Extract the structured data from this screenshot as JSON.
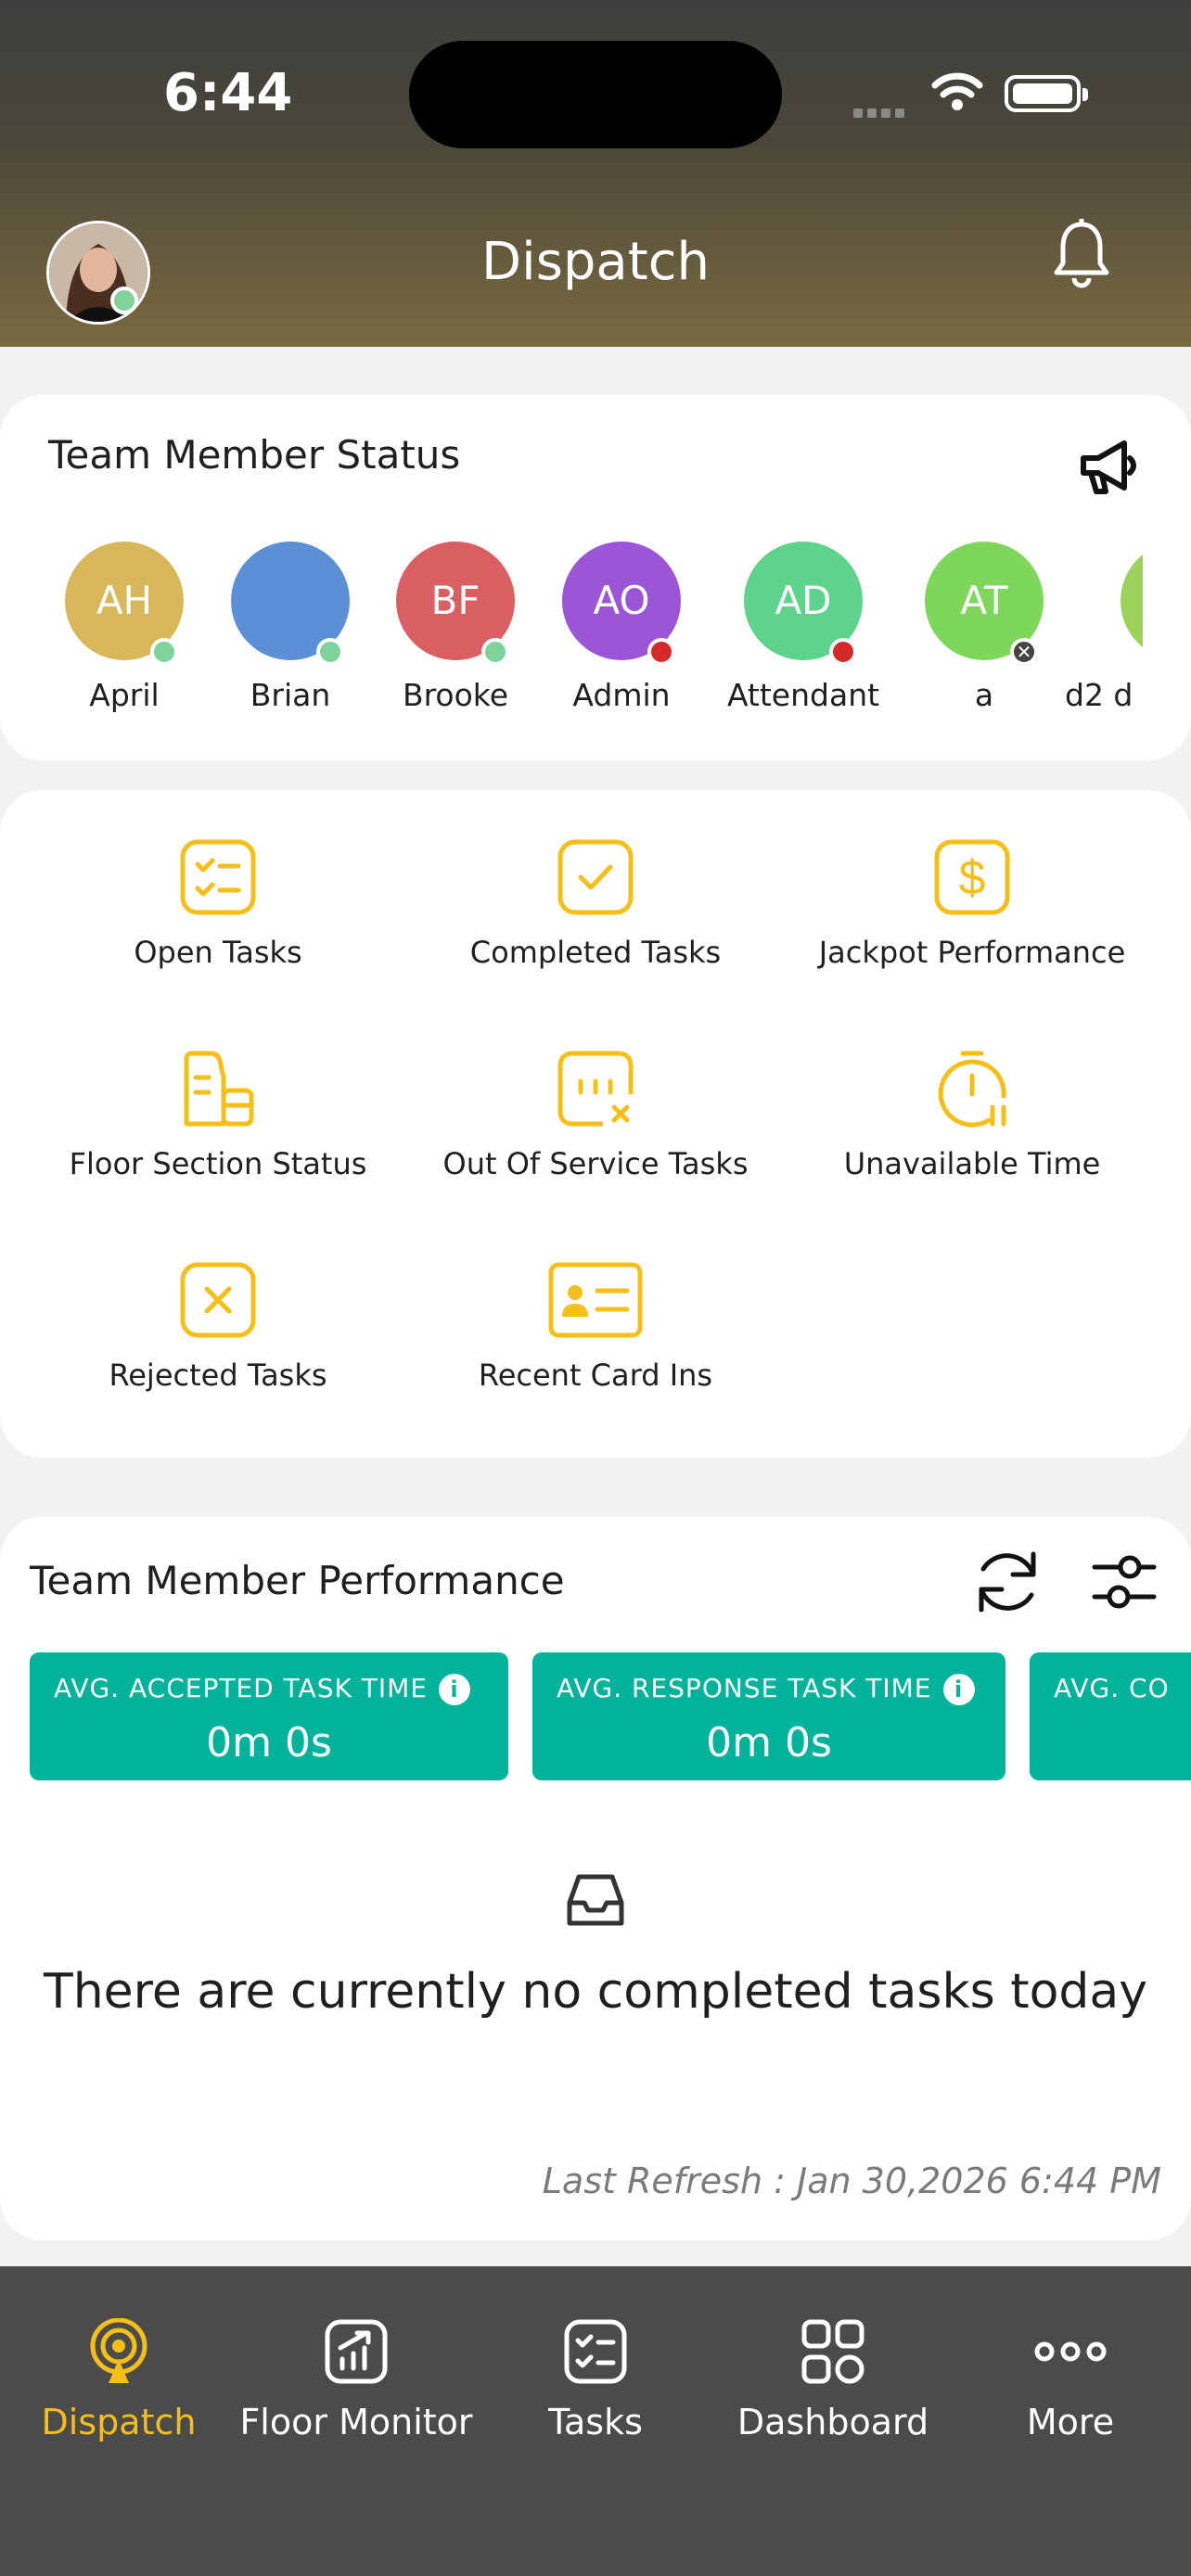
{
  "status_bar": {
    "time": "6:44"
  },
  "header": {
    "title": "Dispatch"
  },
  "team_status": {
    "title": "Team Member Status",
    "members": [
      {
        "initials": "AH",
        "name": "April",
        "color": "#d8b75a",
        "status_color": "#7ed39a"
      },
      {
        "initials": "",
        "name": "Brian",
        "color": "#5b8fd6",
        "status_color": "#7ed39a"
      },
      {
        "initials": "BF",
        "name": "Brooke",
        "color": "#d95f63",
        "status_color": "#7ed39a"
      },
      {
        "initials": "AO",
        "name": "Admin",
        "color": "#9a56d6",
        "status_color": "#d62a2a"
      },
      {
        "initials": "AD",
        "name": "Attendant",
        "color": "#5dd38c",
        "status_color": "#d62a2a"
      },
      {
        "initials": "AT",
        "name": "a",
        "color": "#7ed75a",
        "status_color": "#444444"
      },
      {
        "initials": "",
        "name": "d2 d",
        "color": "#9bd35a",
        "status_color": ""
      }
    ]
  },
  "quick_actions": [
    {
      "label": "Open Tasks",
      "icon": "checklist-icon"
    },
    {
      "label": "Completed Tasks",
      "icon": "check-square-icon"
    },
    {
      "label": "Jackpot Performance",
      "icon": "dollar-icon"
    },
    {
      "label": "Floor Section Status",
      "icon": "floor-section-icon"
    },
    {
      "label": "Out Of Service Tasks",
      "icon": "out-of-service-icon"
    },
    {
      "label": "Unavailable Time",
      "icon": "timer-pause-icon"
    },
    {
      "label": "Rejected Tasks",
      "icon": "x-square-icon"
    },
    {
      "label": "Recent Card Ins",
      "icon": "id-card-icon"
    }
  ],
  "performance": {
    "title": "Team Member Performance",
    "metrics": [
      {
        "label": "AVG. ACCEPTED TASK TIME",
        "value": "0m 0s"
      },
      {
        "label": "AVG. RESPONSE TASK TIME",
        "value": "0m 0s"
      },
      {
        "label": "AVG. CO",
        "value": ""
      }
    ],
    "empty_message": "There are currently no completed tasks today",
    "last_refresh": "Last Refresh : Jan 30,2026 6:44 PM"
  },
  "tabbar": {
    "active": "Dispatch",
    "accent": "#f6bf17",
    "tabs": [
      {
        "label": "Dispatch",
        "icon": "dispatch-icon"
      },
      {
        "label": "Floor Monitor",
        "icon": "floor-monitor-icon"
      },
      {
        "label": "Tasks",
        "icon": "tasks-icon"
      },
      {
        "label": "Dashboard",
        "icon": "dashboard-icon"
      },
      {
        "label": "More",
        "icon": "more-icon"
      }
    ]
  }
}
